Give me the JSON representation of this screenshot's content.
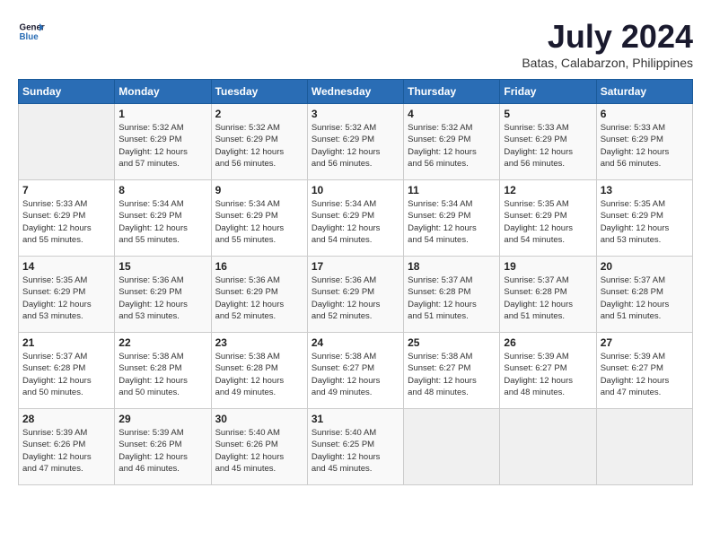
{
  "header": {
    "logo_line1": "General",
    "logo_line2": "Blue",
    "title": "July 2024",
    "location": "Batas, Calabarzon, Philippines"
  },
  "calendar": {
    "days_of_week": [
      "Sunday",
      "Monday",
      "Tuesday",
      "Wednesday",
      "Thursday",
      "Friday",
      "Saturday"
    ],
    "weeks": [
      [
        {
          "day": "",
          "content": ""
        },
        {
          "day": "1",
          "content": "Sunrise: 5:32 AM\nSunset: 6:29 PM\nDaylight: 12 hours\nand 57 minutes."
        },
        {
          "day": "2",
          "content": "Sunrise: 5:32 AM\nSunset: 6:29 PM\nDaylight: 12 hours\nand 56 minutes."
        },
        {
          "day": "3",
          "content": "Sunrise: 5:32 AM\nSunset: 6:29 PM\nDaylight: 12 hours\nand 56 minutes."
        },
        {
          "day": "4",
          "content": "Sunrise: 5:32 AM\nSunset: 6:29 PM\nDaylight: 12 hours\nand 56 minutes."
        },
        {
          "day": "5",
          "content": "Sunrise: 5:33 AM\nSunset: 6:29 PM\nDaylight: 12 hours\nand 56 minutes."
        },
        {
          "day": "6",
          "content": "Sunrise: 5:33 AM\nSunset: 6:29 PM\nDaylight: 12 hours\nand 56 minutes."
        }
      ],
      [
        {
          "day": "7",
          "content": "Sunrise: 5:33 AM\nSunset: 6:29 PM\nDaylight: 12 hours\nand 55 minutes."
        },
        {
          "day": "8",
          "content": "Sunrise: 5:34 AM\nSunset: 6:29 PM\nDaylight: 12 hours\nand 55 minutes."
        },
        {
          "day": "9",
          "content": "Sunrise: 5:34 AM\nSunset: 6:29 PM\nDaylight: 12 hours\nand 55 minutes."
        },
        {
          "day": "10",
          "content": "Sunrise: 5:34 AM\nSunset: 6:29 PM\nDaylight: 12 hours\nand 54 minutes."
        },
        {
          "day": "11",
          "content": "Sunrise: 5:34 AM\nSunset: 6:29 PM\nDaylight: 12 hours\nand 54 minutes."
        },
        {
          "day": "12",
          "content": "Sunrise: 5:35 AM\nSunset: 6:29 PM\nDaylight: 12 hours\nand 54 minutes."
        },
        {
          "day": "13",
          "content": "Sunrise: 5:35 AM\nSunset: 6:29 PM\nDaylight: 12 hours\nand 53 minutes."
        }
      ],
      [
        {
          "day": "14",
          "content": "Sunrise: 5:35 AM\nSunset: 6:29 PM\nDaylight: 12 hours\nand 53 minutes."
        },
        {
          "day": "15",
          "content": "Sunrise: 5:36 AM\nSunset: 6:29 PM\nDaylight: 12 hours\nand 53 minutes."
        },
        {
          "day": "16",
          "content": "Sunrise: 5:36 AM\nSunset: 6:29 PM\nDaylight: 12 hours\nand 52 minutes."
        },
        {
          "day": "17",
          "content": "Sunrise: 5:36 AM\nSunset: 6:29 PM\nDaylight: 12 hours\nand 52 minutes."
        },
        {
          "day": "18",
          "content": "Sunrise: 5:37 AM\nSunset: 6:28 PM\nDaylight: 12 hours\nand 51 minutes."
        },
        {
          "day": "19",
          "content": "Sunrise: 5:37 AM\nSunset: 6:28 PM\nDaylight: 12 hours\nand 51 minutes."
        },
        {
          "day": "20",
          "content": "Sunrise: 5:37 AM\nSunset: 6:28 PM\nDaylight: 12 hours\nand 51 minutes."
        }
      ],
      [
        {
          "day": "21",
          "content": "Sunrise: 5:37 AM\nSunset: 6:28 PM\nDaylight: 12 hours\nand 50 minutes."
        },
        {
          "day": "22",
          "content": "Sunrise: 5:38 AM\nSunset: 6:28 PM\nDaylight: 12 hours\nand 50 minutes."
        },
        {
          "day": "23",
          "content": "Sunrise: 5:38 AM\nSunset: 6:28 PM\nDaylight: 12 hours\nand 49 minutes."
        },
        {
          "day": "24",
          "content": "Sunrise: 5:38 AM\nSunset: 6:27 PM\nDaylight: 12 hours\nand 49 minutes."
        },
        {
          "day": "25",
          "content": "Sunrise: 5:38 AM\nSunset: 6:27 PM\nDaylight: 12 hours\nand 48 minutes."
        },
        {
          "day": "26",
          "content": "Sunrise: 5:39 AM\nSunset: 6:27 PM\nDaylight: 12 hours\nand 48 minutes."
        },
        {
          "day": "27",
          "content": "Sunrise: 5:39 AM\nSunset: 6:27 PM\nDaylight: 12 hours\nand 47 minutes."
        }
      ],
      [
        {
          "day": "28",
          "content": "Sunrise: 5:39 AM\nSunset: 6:26 PM\nDaylight: 12 hours\nand 47 minutes."
        },
        {
          "day": "29",
          "content": "Sunrise: 5:39 AM\nSunset: 6:26 PM\nDaylight: 12 hours\nand 46 minutes."
        },
        {
          "day": "30",
          "content": "Sunrise: 5:40 AM\nSunset: 6:26 PM\nDaylight: 12 hours\nand 45 minutes."
        },
        {
          "day": "31",
          "content": "Sunrise: 5:40 AM\nSunset: 6:25 PM\nDaylight: 12 hours\nand 45 minutes."
        },
        {
          "day": "",
          "content": ""
        },
        {
          "day": "",
          "content": ""
        },
        {
          "day": "",
          "content": ""
        }
      ]
    ]
  }
}
